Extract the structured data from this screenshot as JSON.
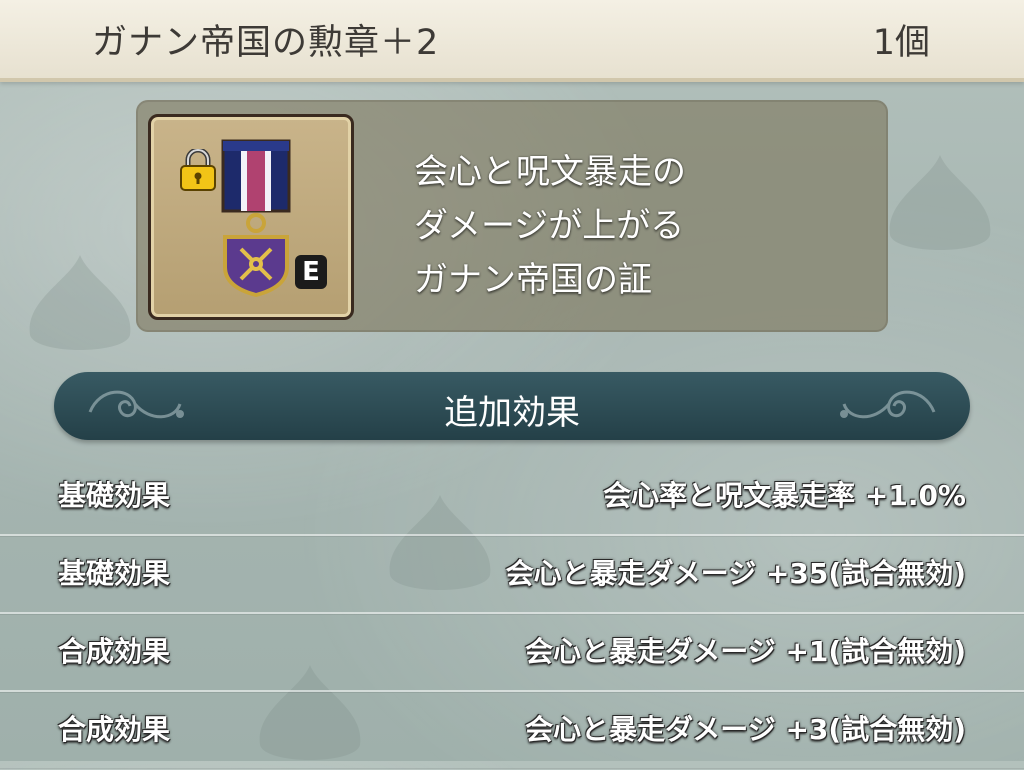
{
  "item": {
    "name": "ガナン帝国の勲章＋2",
    "count": "1個",
    "equipped_badge": "E",
    "description": [
      "会心と呪文暴走の",
      "ダメージが上がる",
      "ガナン帝国の証"
    ]
  },
  "section": {
    "title": "追加効果"
  },
  "effects": [
    {
      "category": "基礎効果",
      "value": "会心率と呪文暴走率 +1.0%"
    },
    {
      "category": "基礎効果",
      "value": "会心と暴走ダメージ +35(試合無効)"
    },
    {
      "category": "合成効果",
      "value": "会心と暴走ダメージ +1(試合無効)"
    },
    {
      "category": "合成効果",
      "value": "会心と暴走ダメージ +3(試合無効)"
    }
  ],
  "icons": {
    "item": "medal-icon",
    "lock": "lock-icon",
    "decor": "swirl-ornament-icon"
  },
  "colors": {
    "title_bar": "#eee8d8",
    "section_header": "#2f4c55",
    "panel": "#8a8160"
  }
}
